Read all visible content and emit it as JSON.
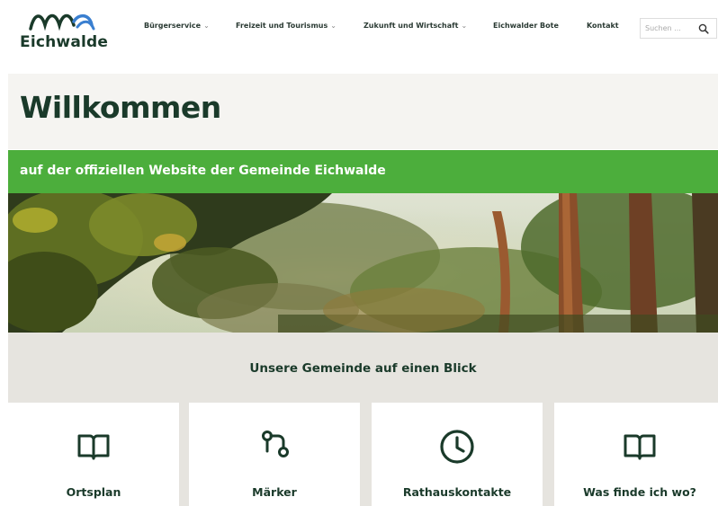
{
  "header": {
    "logo_text": "Eichwalde",
    "nav": [
      {
        "label": "Bürgerservice",
        "has_dropdown": true
      },
      {
        "label": "Freizeit und Tourismus",
        "has_dropdown": true
      },
      {
        "label": "Zukunft und Wirtschaft",
        "has_dropdown": true
      },
      {
        "label": "Eichwalder Bote",
        "has_dropdown": false
      },
      {
        "label": "Kontakt",
        "has_dropdown": false
      }
    ],
    "search": {
      "placeholder": "Suchen ...",
      "icon": "search-icon"
    }
  },
  "welcome": {
    "title": "Willkommen",
    "subtitle": "auf der offiziellen Website der Gemeinde Eichwalde"
  },
  "glance": {
    "heading": "Unsere Gemeinde auf einen Blick"
  },
  "cards": [
    {
      "label": "Ortsplan",
      "icon": "open-book-icon"
    },
    {
      "label": "Märker",
      "icon": "route-pin-icon"
    },
    {
      "label": "Rathauskontakte",
      "icon": "clock-icon"
    },
    {
      "label": "Was finde ich wo?",
      "icon": "open-book-icon"
    }
  ],
  "colors": {
    "brand_dark": "#1a3a2a",
    "brand_green": "#4cae3c",
    "logo_blue": "#3a7fd0",
    "panel_bg": "#f5f4f1",
    "band_bg": "#e6e4df"
  }
}
